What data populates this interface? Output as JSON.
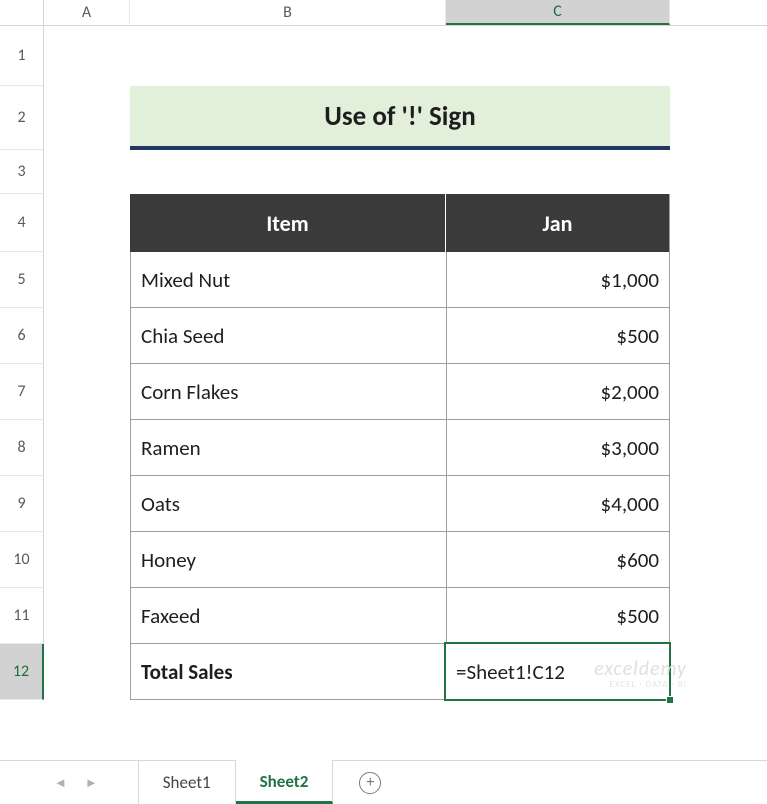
{
  "columns": {
    "A": "A",
    "B": "B",
    "C": "C"
  },
  "rows": [
    "1",
    "2",
    "3",
    "4",
    "5",
    "6",
    "7",
    "8",
    "9",
    "10",
    "11",
    "12"
  ],
  "active_column": "C",
  "active_row": "12",
  "title": "Use of '!' Sign",
  "table_headers": {
    "item": "Item",
    "jan": "Jan"
  },
  "items": [
    {
      "name": "Mixed Nut",
      "jan": "$1,000"
    },
    {
      "name": "Chia Seed",
      "jan": "$500"
    },
    {
      "name": "Corn Flakes",
      "jan": "$2,000"
    },
    {
      "name": "Ramen",
      "jan": "$3,000"
    },
    {
      "name": "Oats",
      "jan": "$4,000"
    },
    {
      "name": "Honey",
      "jan": "$600"
    },
    {
      "name": "Faxeed",
      "jan": "$500"
    }
  ],
  "total_label": "Total Sales",
  "formula": "=Sheet1!C12",
  "tabs": {
    "sheet1": "Sheet1",
    "sheet2": "Sheet2"
  },
  "watermark_lines": [
    "exceldemy",
    "EXCEL · DATA · BI"
  ]
}
